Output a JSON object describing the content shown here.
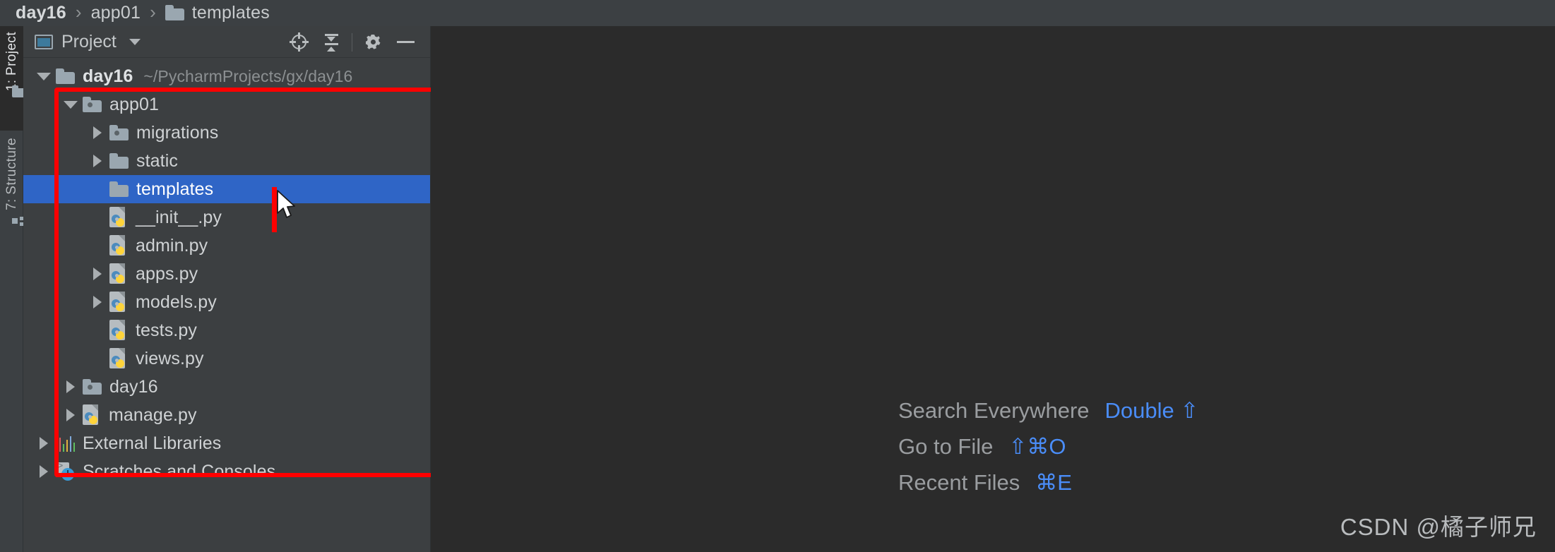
{
  "breadcrumb": {
    "separator": "›",
    "items": [
      {
        "label": "day16",
        "icon": "",
        "bold": true
      },
      {
        "label": "app01",
        "icon": "",
        "bold": false
      },
      {
        "label": "templates",
        "icon": "folder-icon",
        "bold": false
      }
    ]
  },
  "tool_strip": {
    "tabs": [
      {
        "label": "1: Project",
        "icon": "folder-icon",
        "active": true
      },
      {
        "label": "7: Structure",
        "icon": "structure-icon",
        "active": false
      }
    ]
  },
  "project_panel": {
    "title": "Project",
    "title_icon": "project-window-icon",
    "dropdown_icon": "chevron-down-icon",
    "toolbar": [
      {
        "name": "locate-icon",
        "tooltip": "Select Opened File"
      },
      {
        "name": "collapse-all-icon",
        "tooltip": "Collapse All"
      },
      {
        "name": "gear-icon",
        "tooltip": "Settings"
      },
      {
        "name": "minimize-icon",
        "tooltip": "Hide"
      }
    ],
    "tree": [
      {
        "label": "day16",
        "path": "~/PycharmProjects/gx/day16",
        "icon": "folder-icon",
        "arrow": "open",
        "indent": 0,
        "bold": true,
        "selected": false
      },
      {
        "label": "app01",
        "path": "",
        "icon": "module-folder-icon",
        "arrow": "open",
        "indent": 1,
        "bold": false,
        "selected": false
      },
      {
        "label": "migrations",
        "path": "",
        "icon": "module-folder-icon",
        "arrow": "closed",
        "indent": 2,
        "bold": false,
        "selected": false
      },
      {
        "label": "static",
        "path": "",
        "icon": "folder-icon",
        "arrow": "closed",
        "indent": 2,
        "bold": false,
        "selected": false
      },
      {
        "label": "templates",
        "path": "",
        "icon": "folder-icon",
        "arrow": "none",
        "indent": 2,
        "bold": false,
        "selected": true
      },
      {
        "label": "__init__.py",
        "path": "",
        "icon": "python-file-icon",
        "arrow": "none",
        "indent": 2,
        "bold": false,
        "selected": false
      },
      {
        "label": "admin.py",
        "path": "",
        "icon": "python-file-icon",
        "arrow": "none",
        "indent": 2,
        "bold": false,
        "selected": false
      },
      {
        "label": "apps.py",
        "path": "",
        "icon": "python-file-icon",
        "arrow": "closed",
        "indent": 2,
        "bold": false,
        "selected": false
      },
      {
        "label": "models.py",
        "path": "",
        "icon": "python-file-icon",
        "arrow": "closed",
        "indent": 2,
        "bold": false,
        "selected": false
      },
      {
        "label": "tests.py",
        "path": "",
        "icon": "python-file-icon",
        "arrow": "none",
        "indent": 2,
        "bold": false,
        "selected": false
      },
      {
        "label": "views.py",
        "path": "",
        "icon": "python-file-icon",
        "arrow": "none",
        "indent": 2,
        "bold": false,
        "selected": false
      },
      {
        "label": "day16",
        "path": "",
        "icon": "module-folder-icon",
        "arrow": "closed",
        "indent": 1,
        "bold": false,
        "selected": false
      },
      {
        "label": "manage.py",
        "path": "",
        "icon": "python-file-icon",
        "arrow": "closed",
        "indent": 1,
        "bold": false,
        "selected": false
      },
      {
        "label": "External Libraries",
        "path": "",
        "icon": "external-libraries-icon",
        "arrow": "closed",
        "indent": 0,
        "bold": false,
        "selected": false
      },
      {
        "label": "Scratches and Consoles",
        "path": "",
        "icon": "scratches-icon",
        "arrow": "closed",
        "indent": 0,
        "bold": false,
        "selected": false
      }
    ]
  },
  "annotation": {
    "box_color": "#ff0000",
    "drop_caret_color": "#ff0000"
  },
  "editor": {
    "hints": [
      {
        "name": "Search Everywhere",
        "shortcut": "Double ⇧"
      },
      {
        "name": "Go to File",
        "shortcut": "⇧⌘O"
      },
      {
        "name": "Recent Files",
        "shortcut": "⌘E"
      }
    ],
    "watermark": "CSDN @橘子师兄"
  },
  "colors": {
    "panel_bg": "#3c3f41",
    "editor_bg": "#2b2b2b",
    "selection": "#2f65c6",
    "accent_blue": "#4a8df8",
    "annotation_red": "#ff0000"
  }
}
